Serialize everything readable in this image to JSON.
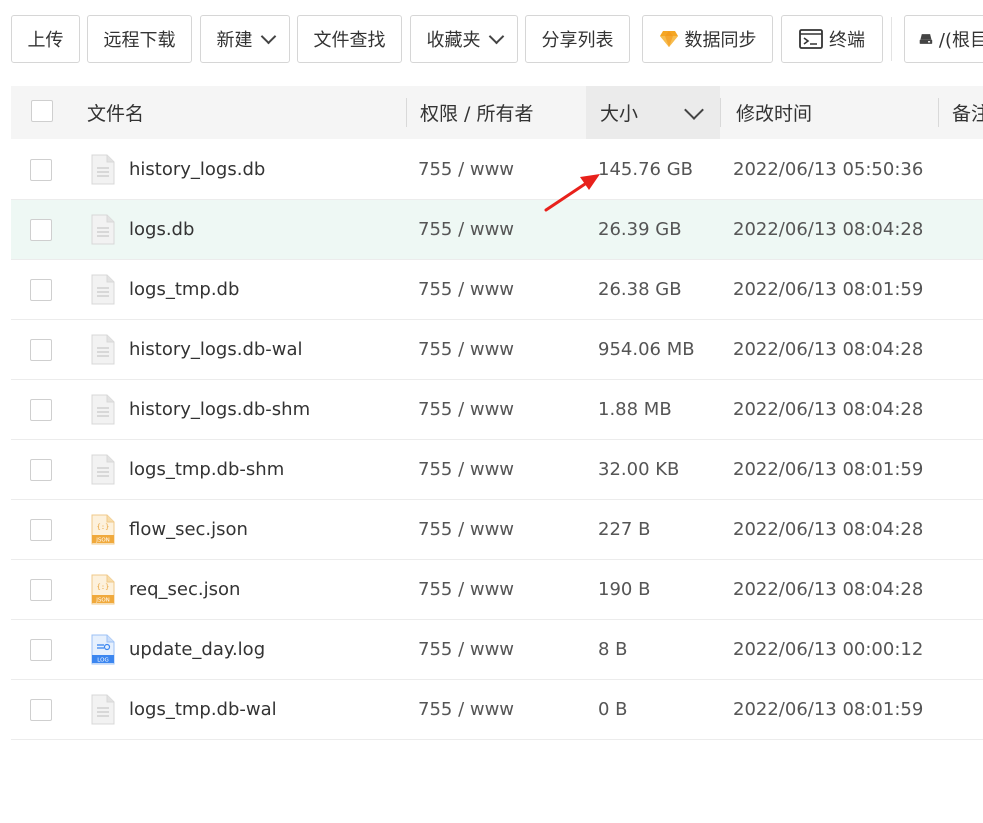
{
  "toolbar": {
    "upload": "上传",
    "remote_download": "远程下载",
    "new": "新建",
    "file_search": "文件查找",
    "favorites": "收藏夹",
    "share_list": "分享列表",
    "data_sync": "数据同步",
    "terminal": "终端",
    "root_path": "/(根目录)"
  },
  "table": {
    "headers": {
      "name": "文件名",
      "perm_owner": "权限 / 所有者",
      "size": "大小",
      "modified": "修改时间",
      "note": "备注"
    },
    "rows": [
      {
        "name": "history_logs.db",
        "perm": "755 / www",
        "size": "145.76 GB",
        "modified": "2022/06/13 05:50:36",
        "type": "file"
      },
      {
        "name": "logs.db",
        "perm": "755 / www",
        "size": "26.39 GB",
        "modified": "2022/06/13 08:04:28",
        "type": "file"
      },
      {
        "name": "logs_tmp.db",
        "perm": "755 / www",
        "size": "26.38 GB",
        "modified": "2022/06/13 08:01:59",
        "type": "file"
      },
      {
        "name": "history_logs.db-wal",
        "perm": "755 / www",
        "size": "954.06 MB",
        "modified": "2022/06/13 08:04:28",
        "type": "file"
      },
      {
        "name": "history_logs.db-shm",
        "perm": "755 / www",
        "size": "1.88 MB",
        "modified": "2022/06/13 08:04:28",
        "type": "file"
      },
      {
        "name": "logs_tmp.db-shm",
        "perm": "755 / www",
        "size": "32.00 KB",
        "modified": "2022/06/13 08:01:59",
        "type": "file"
      },
      {
        "name": "flow_sec.json",
        "perm": "755 / www",
        "size": "227 B",
        "modified": "2022/06/13 08:04:28",
        "type": "json"
      },
      {
        "name": "req_sec.json",
        "perm": "755 / www",
        "size": "190 B",
        "modified": "2022/06/13 08:04:28",
        "type": "json"
      },
      {
        "name": "update_day.log",
        "perm": "755 / www",
        "size": "8 B",
        "modified": "2022/06/13 00:00:12",
        "type": "log"
      },
      {
        "name": "logs_tmp.db-wal",
        "perm": "755 / www",
        "size": "0 B",
        "modified": "2022/06/13 08:01:59",
        "type": "file"
      }
    ]
  },
  "icons": {
    "generic_file": "file-icon",
    "json_file": "json-file-icon",
    "log_file": "log-file-icon",
    "data_sync": "diamond-icon",
    "terminal": "terminal-icon",
    "disk": "disk-icon"
  },
  "colors": {
    "highlight_row": "#eef8f4",
    "json_icon": "#f0a93c",
    "log_icon": "#3b86f0",
    "arrow": "#e8211b",
    "diamond": "#f5a623"
  }
}
